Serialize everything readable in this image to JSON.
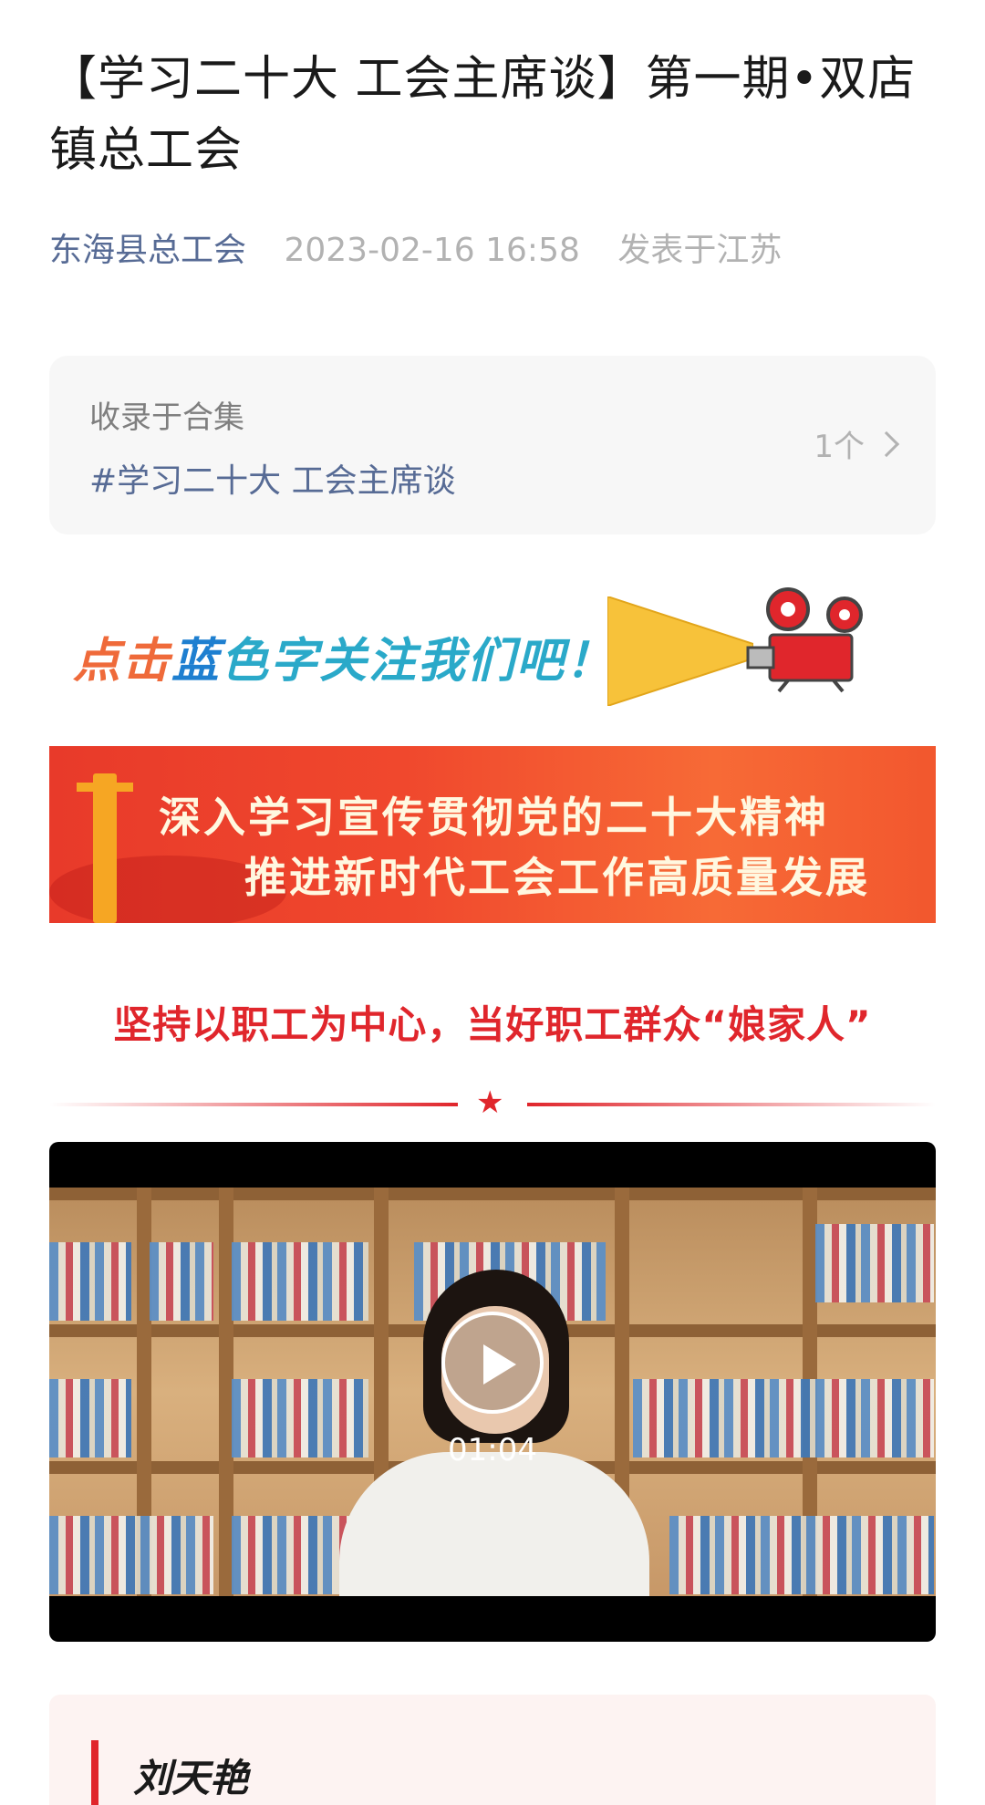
{
  "article": {
    "title": "【学习二十大 工会主席谈】第一期•双店镇总工会",
    "author": "东海县总工会",
    "date": "2023-02-16 16:58",
    "location": "发表于江苏"
  },
  "collection": {
    "label": "收录于合集",
    "tag": "#学习二十大 工会主席谈",
    "count": "1个"
  },
  "follow_banner": {
    "part1": "点击",
    "part2": "蓝",
    "part3": "色",
    "part4": "字关注我们吧！"
  },
  "header_banner": {
    "line1": "深入学习宣传贯彻党的二十大精神",
    "line2": "推进新时代工会工作高质量发展"
  },
  "subheading": "坚持以职工为中心，当好职工群众“娘家人”",
  "divider_star": "★",
  "video": {
    "duration": "01:04"
  },
  "bio": {
    "name": "刘天艳"
  },
  "colors": {
    "accent_red": "#e0262c",
    "link_blue": "#576b95",
    "muted_gray": "#b2b2b2"
  }
}
